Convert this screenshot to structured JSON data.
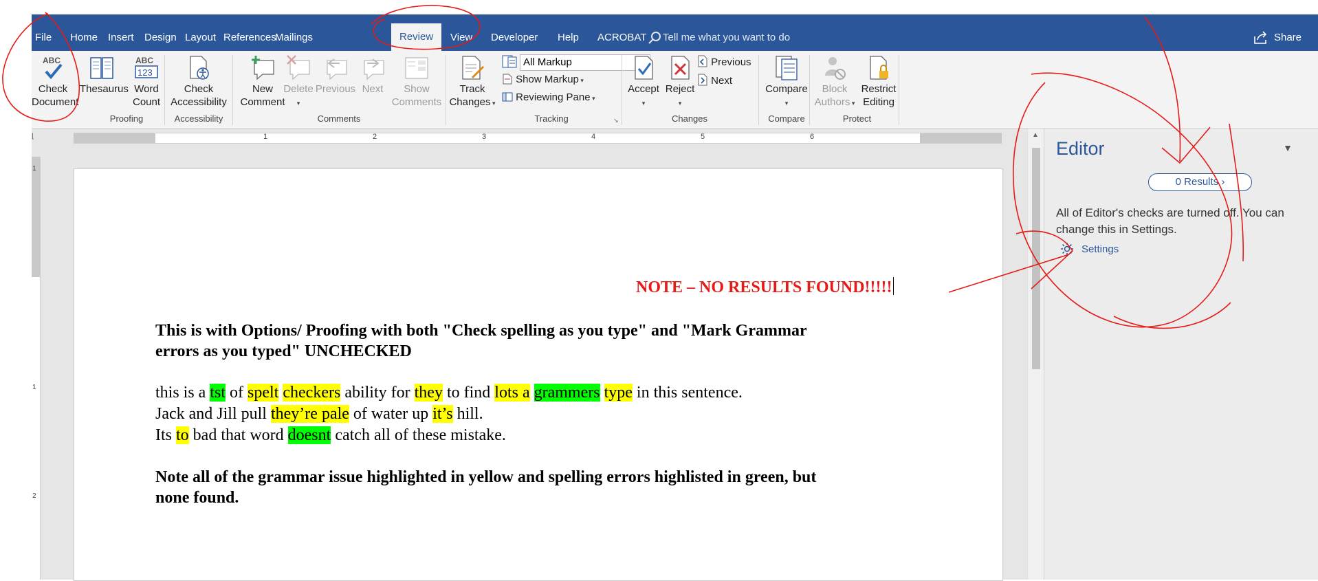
{
  "tabs": [
    {
      "label": "File"
    },
    {
      "label": "Home"
    },
    {
      "label": "Insert"
    },
    {
      "label": "Design"
    },
    {
      "label": "Layout"
    },
    {
      "label": "References"
    },
    {
      "label": "Mailings"
    },
    {
      "label": "Review"
    },
    {
      "label": "View"
    },
    {
      "label": "Developer"
    },
    {
      "label": "Help"
    },
    {
      "label": "ACROBAT"
    }
  ],
  "active_tab": "Review",
  "tell_me": "Tell me what you want to do",
  "share": "Share",
  "ribbon": {
    "check_document": {
      "line1": "Check",
      "line2": "Document"
    },
    "thesaurus": "Thesaurus",
    "word_count": {
      "line1": "Word",
      "line2": "Count"
    },
    "proofing": "Proofing",
    "check_accessibility": {
      "line1": "Check",
      "line2": "Accessibility"
    },
    "accessibility": "Accessibility",
    "new_comment": {
      "line1": "New",
      "line2": "Comment"
    },
    "delete": "Delete",
    "previous": "Previous",
    "next": "Next",
    "show_comments": {
      "line1": "Show",
      "line2": "Comments"
    },
    "comments": "Comments",
    "track_changes": {
      "line1": "Track",
      "line2": "Changes"
    },
    "markup_value": "All Markup",
    "show_markup": "Show Markup",
    "reviewing_pane": "Reviewing Pane",
    "tracking": "Tracking",
    "accept": "Accept",
    "reject": "Reject",
    "changes_previous": "Previous",
    "changes_next": "Next",
    "changes": "Changes",
    "compare_btn": "Compare",
    "compare": "Compare",
    "block_authors": {
      "line1": "Block",
      "line2": "Authors"
    },
    "restrict_editing": {
      "line1": "Restrict",
      "line2": "Editing"
    },
    "protect": "Protect"
  },
  "ruler_numbers": [
    "1",
    "2",
    "3",
    "4",
    "5",
    "6"
  ],
  "vruler_numbers": [
    "1",
    "1",
    "2"
  ],
  "document": {
    "note": "NOTE – NO RESULTS FOUND!!!!!",
    "p1_line1": "This is with Options/ Proofing with both \"Check spelling as you type\" and \"Mark Grammar",
    "p1_line2": "errors as you typed\" UNCHECKED",
    "l1": [
      "this is a ",
      "tst",
      " of ",
      "spelt",
      " ",
      "checkers",
      " ability for ",
      "they",
      " to find ",
      "lots a",
      " ",
      "grammers",
      " ",
      "type",
      " in this sentence."
    ],
    "l2": [
      "Jack and Jill pull ",
      "they’re pale",
      " of water up ",
      "it’s",
      " hill."
    ],
    "l3": [
      "Its ",
      "to",
      " bad that word ",
      "doesnt",
      " catch all of these mistake."
    ],
    "p3_line1": "Note all of the grammar issue highlighted in yellow and spelling errors highlisted in green, but",
    "p3_line2": "none found."
  },
  "editor": {
    "title": "Editor",
    "results_button": "0 Results",
    "message": "All of Editor's checks are turned off. You can change this in Settings.",
    "settings_link": "Settings"
  },
  "colors": {
    "accent": "#2b579a",
    "highlight_grammar": "#ffff00",
    "highlight_spelling": "#00ff00",
    "annotation_red": "#e41b17"
  }
}
